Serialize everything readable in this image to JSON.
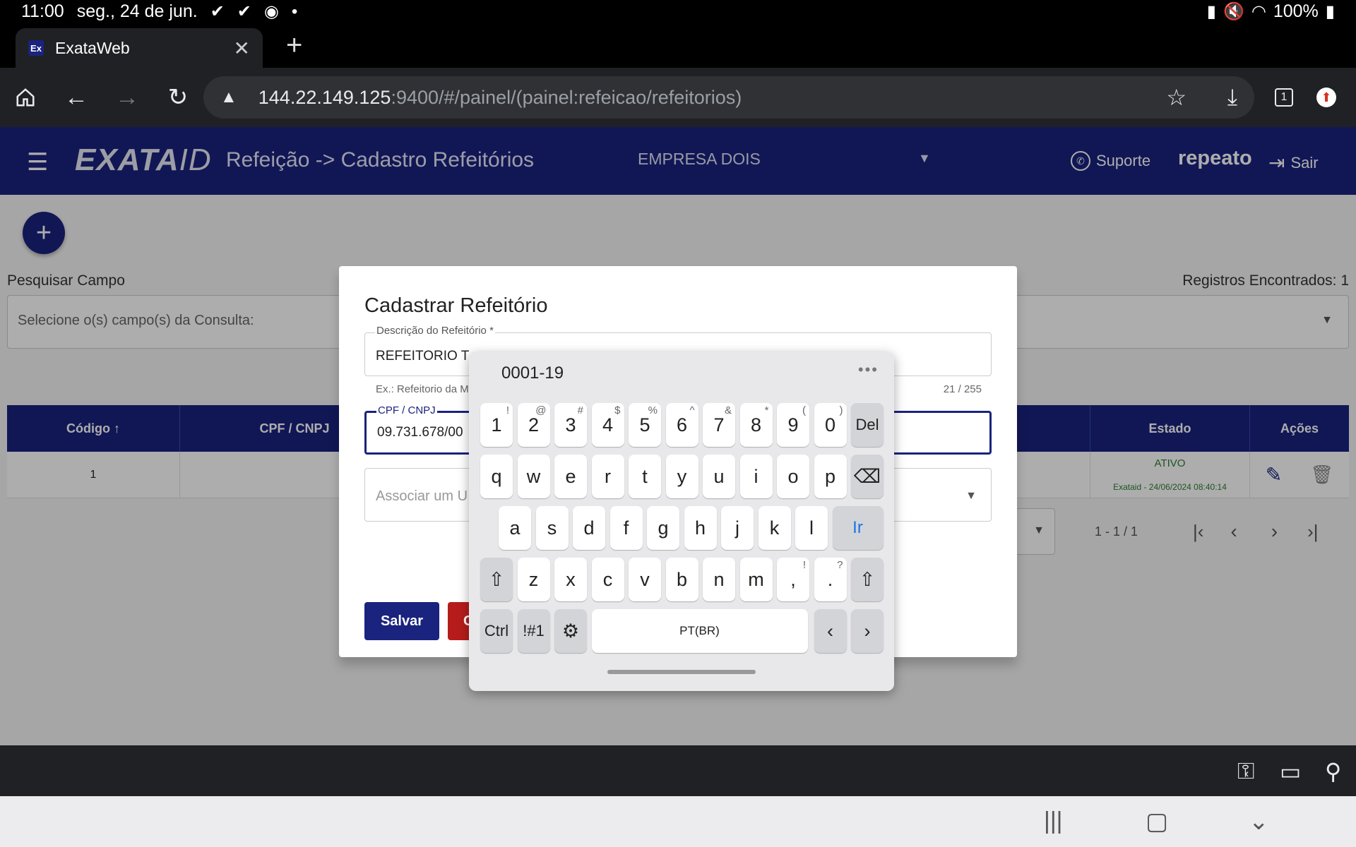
{
  "status": {
    "time": "11:00",
    "date": "seg., 24 de jun.",
    "battery": "100%"
  },
  "browser": {
    "tab_title": "ExataWeb",
    "favicon_text": "Ex",
    "url_host": "144.22.149.125",
    "url_path": ":9400/#/painel/(painel:refeicao/refeitorios)",
    "tab_count": "1"
  },
  "app": {
    "logo_main": "EXATA",
    "logo_id": "ID",
    "page_title": "Refeição -> Cadastro Refeitórios",
    "company": "EMPRESA DOIS",
    "support": "Suporte",
    "user": "repeato",
    "logout": "Sair",
    "search_label": "Pesquisar Campo",
    "records_found": "Registros Encontrados: 1",
    "search_placeholder": "Selecione o(s) campo(s) da Consulta:",
    "table": {
      "headers": [
        "Código",
        "CPF / CNPJ",
        "Estado",
        "Ações"
      ],
      "rows": [
        {
          "codigo": "1",
          "estado": "ATIVO",
          "estado_ts": "Exataid - 24/06/2024 08:40:14"
        }
      ]
    },
    "pager_range": "1 - 1 / 1"
  },
  "dialog": {
    "title": "Cadastrar Refeitório",
    "desc_label": "Descrição do Refeitório *",
    "desc_value": "REFEITORIO T",
    "desc_hint": "Ex.: Refeitorio da M",
    "desc_counter": "21 / 255",
    "cpf_label": "CPF / CNPJ",
    "cpf_value": "09.731.678/00",
    "assoc_placeholder": "Associar um U",
    "save": "Salvar",
    "cancel": "C"
  },
  "keyboard": {
    "suggestion": "0001-19",
    "row1": [
      {
        "k": "1",
        "s": "!"
      },
      {
        "k": "2",
        "s": "@"
      },
      {
        "k": "3",
        "s": "#"
      },
      {
        "k": "4",
        "s": "$"
      },
      {
        "k": "5",
        "s": "%"
      },
      {
        "k": "6",
        "s": "^"
      },
      {
        "k": "7",
        "s": "&"
      },
      {
        "k": "8",
        "s": "*"
      },
      {
        "k": "9",
        "s": "("
      },
      {
        "k": "0",
        "s": ")"
      }
    ],
    "del": "Del",
    "row2": [
      "q",
      "w",
      "e",
      "r",
      "t",
      "y",
      "u",
      "i",
      "o",
      "p"
    ],
    "row3": [
      "a",
      "s",
      "d",
      "f",
      "g",
      "h",
      "j",
      "k",
      "l"
    ],
    "go": "Ir",
    "row4": [
      "z",
      "x",
      "c",
      "v",
      "b",
      "n",
      "m"
    ],
    "comma_sup": "!",
    "period_sup": "?",
    "ctrl": "Ctrl",
    "sym": "!#1",
    "space": "PT(BR)"
  },
  "colors": {
    "brand": "#1a237e",
    "danger": "#b71c1c",
    "active": "#2e7d32"
  }
}
